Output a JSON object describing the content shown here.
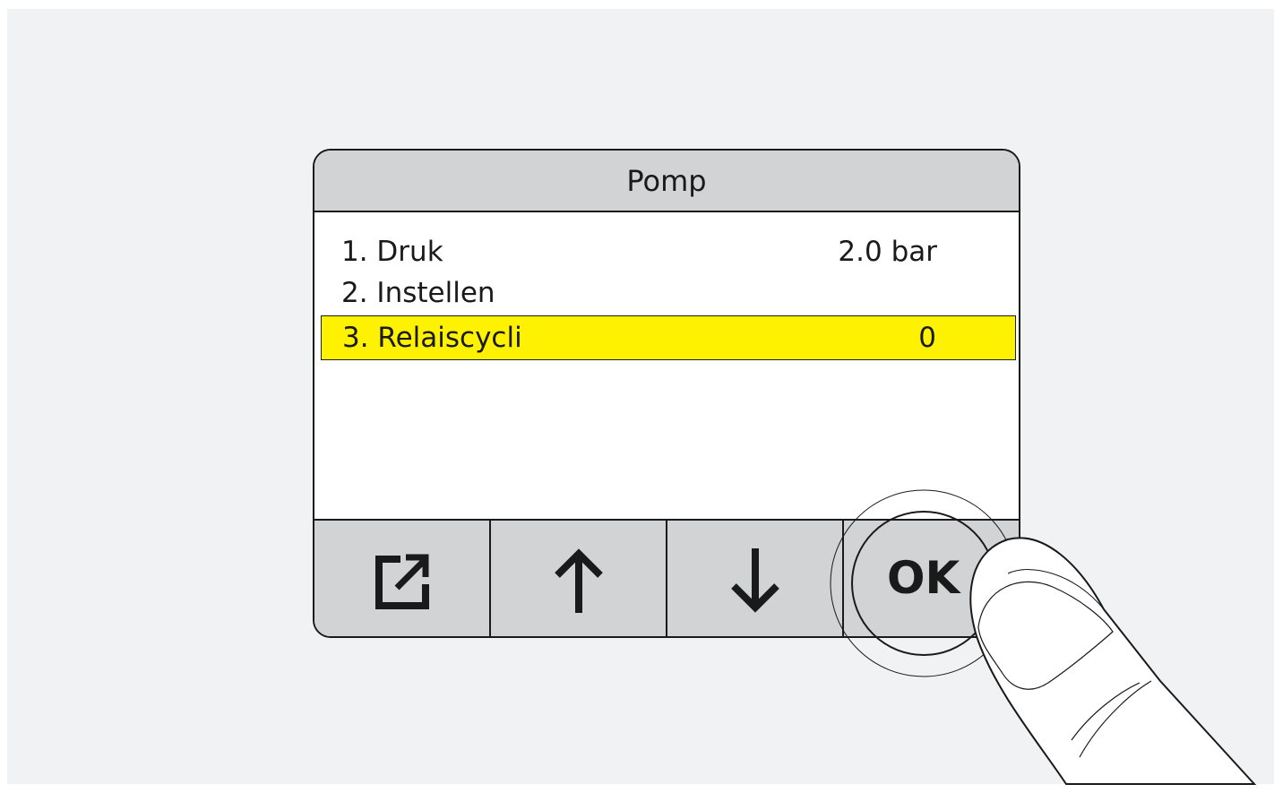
{
  "screen": {
    "title": "Pomp"
  },
  "menu": {
    "items": [
      {
        "label": "1. Druk",
        "value": "2.0 bar"
      },
      {
        "label": "2. Instellen",
        "value": ""
      },
      {
        "label": "3. Relaiscycli",
        "value": "0"
      }
    ],
    "selected_index": 2
  },
  "softkeys": {
    "back_icon": "external-link-icon",
    "up_icon": "arrow-up-icon",
    "down_icon": "arrow-down-icon",
    "ok_label": "OK"
  },
  "colors": {
    "highlight": "#fff200",
    "panel_gray": "#d2d3d5",
    "background": "#f1f2f4"
  }
}
